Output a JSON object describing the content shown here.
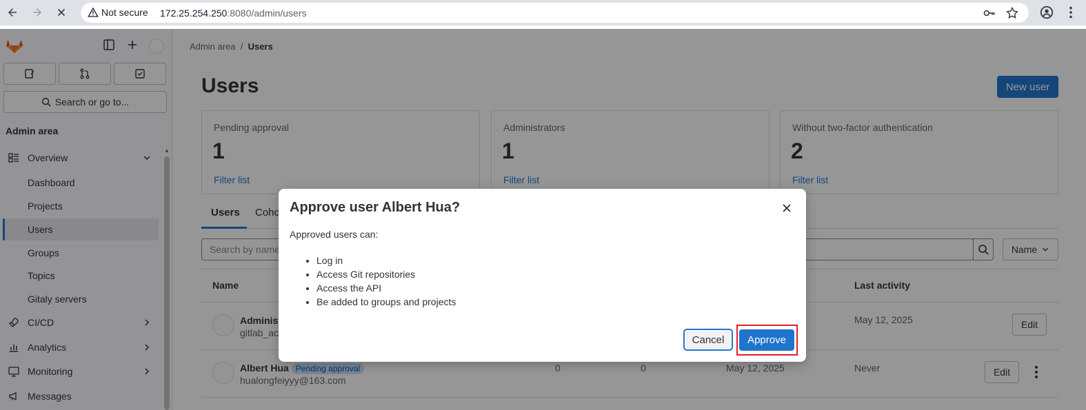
{
  "browser": {
    "security_label": "Not secure",
    "url_host": "172.25.254.250",
    "url_rest": ":8080/admin/users"
  },
  "sidebar": {
    "search_label": "Search or go to...",
    "section_title": "Admin area",
    "items": [
      {
        "label": "Overview",
        "icon": "overview-icon"
      },
      {
        "label": "Dashboard"
      },
      {
        "label": "Projects"
      },
      {
        "label": "Users"
      },
      {
        "label": "Groups"
      },
      {
        "label": "Topics"
      },
      {
        "label": "Gitaly servers"
      },
      {
        "label": "CI/CD",
        "icon": "rocket-icon"
      },
      {
        "label": "Analytics",
        "icon": "chart-icon"
      },
      {
        "label": "Monitoring",
        "icon": "monitor-icon"
      },
      {
        "label": "Messages",
        "icon": "megaphone-icon"
      }
    ]
  },
  "breadcrumb": {
    "parent": "Admin area",
    "separator": "/",
    "current": "Users"
  },
  "page": {
    "title": "Users",
    "new_user_label": "New user"
  },
  "stats": [
    {
      "label": "Pending approval",
      "value": "1",
      "link": "Filter list"
    },
    {
      "label": "Administrators",
      "value": "1",
      "link": "Filter list"
    },
    {
      "label": "Without two-factor authentication",
      "value": "2",
      "link": "Filter list"
    }
  ],
  "tabs": [
    {
      "label": "Users"
    },
    {
      "label": "Coho"
    }
  ],
  "search": {
    "placeholder": "Search by name"
  },
  "sort": {
    "label": "Name"
  },
  "table": {
    "headers": {
      "name": "Name",
      "last_activity": "Last activity"
    },
    "rows": [
      {
        "name": "Administ",
        "email": "gitlab_ac",
        "last_activity": "May 12, 2025",
        "edit_label": "Edit"
      },
      {
        "name": "Albert Hua",
        "badge": "Pending approval",
        "email": "hualongfeiyyy@163.com",
        "projects": "0",
        "groups": "0",
        "created": "May 12, 2025",
        "last_activity": "Never",
        "edit_label": "Edit"
      }
    ]
  },
  "modal": {
    "title": "Approve user Albert Hua?",
    "intro": "Approved users can:",
    "bullets": [
      "Log in",
      "Access Git repositories",
      "Access the API",
      "Be added to groups and projects"
    ],
    "cancel_label": "Cancel",
    "approve_label": "Approve"
  },
  "colors": {
    "accent": "#1f75cb",
    "highlight": "#e0202a",
    "badge_bg": "#cbe2f9"
  }
}
